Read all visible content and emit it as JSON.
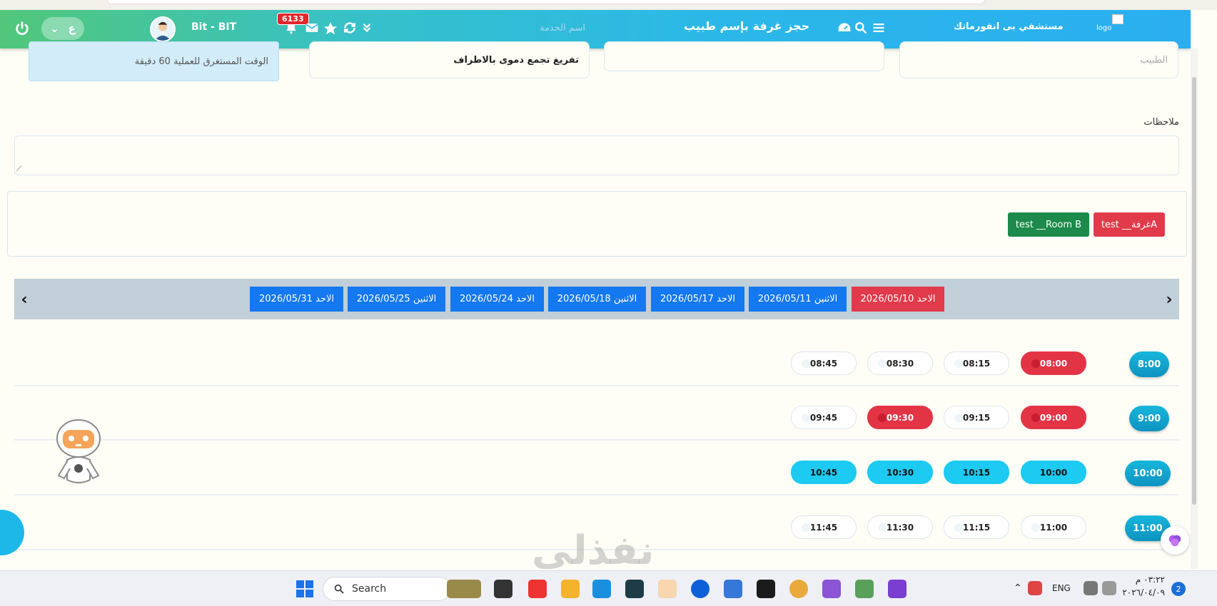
{
  "navbar": {
    "lang": "ع",
    "user_name": "Bit - BIT",
    "notifications": "6133",
    "service_placeholder": "اسم الخدمة",
    "page_title": "حجز غرفة بإسم طبيب",
    "hospital_name": "مستشفي بى انفورماتك",
    "logo_alt": "logo"
  },
  "form": {
    "duration_text": "الوقت المستغرق للعملية 60 دقيقة",
    "service_value": "تفريغ تجمع دموى بالاطراف",
    "doctor_placeholder": "الطبيب",
    "notes_label": "ملاحظات"
  },
  "rooms": [
    {
      "label": "test __غرفةA",
      "color": "#e13a4a"
    },
    {
      "label": "test __Room B",
      "color": "#1c8a4a"
    }
  ],
  "dates": [
    {
      "label": "الاحد 2026/05/10",
      "active": true
    },
    {
      "label": "الاثنين 2026/05/11",
      "active": false
    },
    {
      "label": "الاحد 2026/05/17",
      "active": false
    },
    {
      "label": "الاثنين 2026/05/18",
      "active": false
    },
    {
      "label": "الاحد 2026/05/24",
      "active": false
    },
    {
      "label": "الاثنين 2026/05/25",
      "active": false
    },
    {
      "label": "الاحد 2026/05/31",
      "active": false
    }
  ],
  "schedule": [
    {
      "hour": "8:00",
      "slots": [
        {
          "time": "08:00",
          "state": "booked"
        },
        {
          "time": "08:15",
          "state": "free"
        },
        {
          "time": "08:30",
          "state": "free"
        },
        {
          "time": "08:45",
          "state": "free"
        }
      ]
    },
    {
      "hour": "9:00",
      "slots": [
        {
          "time": "09:00",
          "state": "booked"
        },
        {
          "time": "09:15",
          "state": "free"
        },
        {
          "time": "09:30",
          "state": "booked"
        },
        {
          "time": "09:45",
          "state": "free"
        }
      ]
    },
    {
      "hour": "10:00",
      "slots": [
        {
          "time": "10:00",
          "state": "selected"
        },
        {
          "time": "10:15",
          "state": "selected"
        },
        {
          "time": "10:30",
          "state": "selected"
        },
        {
          "time": "10:45",
          "state": "selected"
        }
      ]
    },
    {
      "hour": "11:00",
      "slots": [
        {
          "time": "11:00",
          "state": "free"
        },
        {
          "time": "11:15",
          "state": "free"
        },
        {
          "time": "11:30",
          "state": "free"
        },
        {
          "time": "11:45",
          "state": "free"
        }
      ]
    }
  ],
  "watermark": "نفذلي",
  "taskbar": {
    "search_label": "Search",
    "lang": "ENG",
    "time": "٠٣:٢٢ م",
    "date": "٢٠٢٦/٠٤/٠٩",
    "notification_count": "2"
  },
  "colors": {
    "booked": "#e33446",
    "selected": "#1ccaf2",
    "date_active": "#e13a4a",
    "date_default": "#1478f0"
  }
}
